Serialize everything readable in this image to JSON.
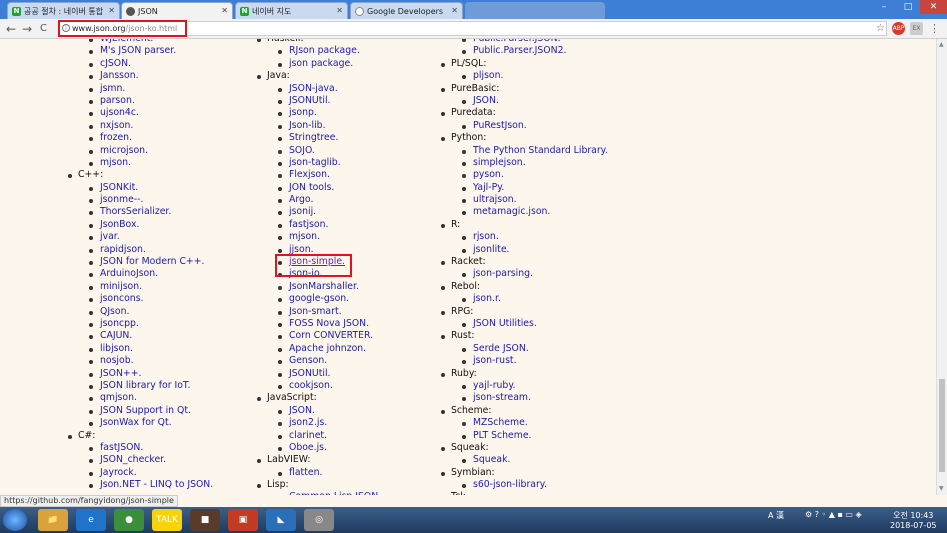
{
  "tabs": [
    {
      "label": "공공 절차 : 네이버 통합",
      "favicon_color": "#19a82b",
      "favicon_letter": "N",
      "active": false
    },
    {
      "label": "JSON",
      "favicon_color": "#555555",
      "favicon_letter": "",
      "active": true
    },
    {
      "label": "네이버 지도",
      "favicon_color": "#19a82b",
      "favicon_letter": "N",
      "active": false
    },
    {
      "label": "Google Developers",
      "favicon_color": "#888888",
      "favicon_letter": "",
      "active": false
    },
    {
      "label": "",
      "favicon_color": "#c9daf0",
      "favicon_letter": "",
      "active": false
    }
  ],
  "window_controls": {
    "minimize": "–",
    "maximize": "□",
    "close": "✕"
  },
  "toolbar": {
    "back": "←",
    "forward": "→",
    "reload": "C",
    "url_host": "www.json.org",
    "url_path": "/json-ko.html",
    "info_icon": "i",
    "star": "☆"
  },
  "columns": {
    "col1": [
      {
        "type": "lib",
        "text": "WJElement."
      },
      {
        "type": "lib",
        "text": "M's JSON parser."
      },
      {
        "type": "lib",
        "text": "cJSON."
      },
      {
        "type": "lib",
        "text": "Jansson."
      },
      {
        "type": "lib",
        "text": "jsmn."
      },
      {
        "type": "lib",
        "text": "parson."
      },
      {
        "type": "lib",
        "text": "ujson4c."
      },
      {
        "type": "lib",
        "text": "nxjson."
      },
      {
        "type": "lib",
        "text": "frozen."
      },
      {
        "type": "lib",
        "text": "microjson."
      },
      {
        "type": "lib",
        "text": "mjson."
      },
      {
        "type": "cat",
        "text": "C++:"
      },
      {
        "type": "lib",
        "text": "JSONKit."
      },
      {
        "type": "lib",
        "text": "jsonme--."
      },
      {
        "type": "lib",
        "text": "ThorsSerializer."
      },
      {
        "type": "lib",
        "text": "JsonBox."
      },
      {
        "type": "lib",
        "text": "jvar."
      },
      {
        "type": "lib",
        "text": "rapidjson."
      },
      {
        "type": "lib",
        "text": "JSON for Modern C++."
      },
      {
        "type": "lib",
        "text": "ArduinoJson."
      },
      {
        "type": "lib",
        "text": "minijson."
      },
      {
        "type": "lib",
        "text": "jsoncons."
      },
      {
        "type": "lib",
        "text": "QJson."
      },
      {
        "type": "lib",
        "text": "jsoncpp."
      },
      {
        "type": "lib",
        "text": "CAJUN."
      },
      {
        "type": "lib",
        "text": "libjson."
      },
      {
        "type": "lib",
        "text": "nosjob."
      },
      {
        "type": "lib",
        "text": "JSON++."
      },
      {
        "type": "lib",
        "text": "JSON library for IoT."
      },
      {
        "type": "lib",
        "text": "qmjson."
      },
      {
        "type": "lib",
        "text": "JSON Support in Qt."
      },
      {
        "type": "lib",
        "text": "JsonWax for Qt."
      },
      {
        "type": "cat",
        "text": "C#:"
      },
      {
        "type": "lib",
        "text": "fastJSON."
      },
      {
        "type": "lib",
        "text": "JSON_checker."
      },
      {
        "type": "lib",
        "text": "Jayrock."
      },
      {
        "type": "lib",
        "text": "Json.NET - LINQ to JSON."
      }
    ],
    "col2": [
      {
        "type": "cat",
        "text": "Haskell:"
      },
      {
        "type": "lib",
        "text": "RJson package."
      },
      {
        "type": "lib",
        "text": "json package."
      },
      {
        "type": "cat",
        "text": "Java:"
      },
      {
        "type": "lib",
        "text": "JSON-java."
      },
      {
        "type": "lib",
        "text": "JSONUtil."
      },
      {
        "type": "lib",
        "text": "jsonp."
      },
      {
        "type": "lib",
        "text": "Json-lib."
      },
      {
        "type": "lib",
        "text": "Stringtree."
      },
      {
        "type": "lib",
        "text": "SOJO."
      },
      {
        "type": "lib",
        "text": "json-taglib."
      },
      {
        "type": "lib",
        "text": "Flexjson."
      },
      {
        "type": "lib",
        "text": "JON tools."
      },
      {
        "type": "lib",
        "text": "Argo."
      },
      {
        "type": "lib",
        "text": "jsonij."
      },
      {
        "type": "lib",
        "text": "fastjson."
      },
      {
        "type": "lib",
        "text": "mjson."
      },
      {
        "type": "lib",
        "text": "jjson."
      },
      {
        "type": "lib",
        "text": "json-simple.",
        "visited": true
      },
      {
        "type": "lib",
        "text": "json-io."
      },
      {
        "type": "lib",
        "text": "JsonMarshaller."
      },
      {
        "type": "lib",
        "text": "google-gson."
      },
      {
        "type": "lib",
        "text": "Json-smart."
      },
      {
        "type": "lib",
        "text": "FOSS Nova JSON."
      },
      {
        "type": "lib",
        "text": "Corn CONVERTER."
      },
      {
        "type": "lib",
        "text": "Apache johnzon."
      },
      {
        "type": "lib",
        "text": "Genson."
      },
      {
        "type": "lib",
        "text": "JSONUtil."
      },
      {
        "type": "lib",
        "text": "cookjson."
      },
      {
        "type": "cat",
        "text": "JavaScript:"
      },
      {
        "type": "lib",
        "text": "JSON."
      },
      {
        "type": "lib",
        "text": "json2.js."
      },
      {
        "type": "lib",
        "text": "clarinet."
      },
      {
        "type": "lib",
        "text": "Oboe.js."
      },
      {
        "type": "cat",
        "text": "LabVIEW:"
      },
      {
        "type": "lib",
        "text": "flatten."
      },
      {
        "type": "cat",
        "text": "Lisp:"
      },
      {
        "type": "lib",
        "text": "Common Lisp JSON."
      }
    ],
    "col3": [
      {
        "type": "lib",
        "text": "Public.Parser.JSON."
      },
      {
        "type": "lib",
        "text": "Public.Parser.JSON2."
      },
      {
        "type": "cat",
        "text": "PL/SQL:"
      },
      {
        "type": "lib",
        "text": "pljson."
      },
      {
        "type": "cat",
        "text": "PureBasic:"
      },
      {
        "type": "lib",
        "text": "JSON."
      },
      {
        "type": "cat",
        "text": "Puredata:"
      },
      {
        "type": "lib",
        "text": "PuRestJson."
      },
      {
        "type": "cat",
        "text": "Python:"
      },
      {
        "type": "lib",
        "text": "The Python Standard Library."
      },
      {
        "type": "lib",
        "text": "simplejson."
      },
      {
        "type": "lib",
        "text": "pyson."
      },
      {
        "type": "lib",
        "text": "Yajl-Py."
      },
      {
        "type": "lib",
        "text": "ultrajson."
      },
      {
        "type": "lib",
        "text": "metamagic.json."
      },
      {
        "type": "cat",
        "text": "R:"
      },
      {
        "type": "lib",
        "text": "rjson."
      },
      {
        "type": "lib",
        "text": "jsonlite."
      },
      {
        "type": "cat",
        "text": "Racket:"
      },
      {
        "type": "lib",
        "text": "json-parsing."
      },
      {
        "type": "cat",
        "text": "Rebol:"
      },
      {
        "type": "lib",
        "text": "json.r."
      },
      {
        "type": "cat",
        "text": "RPG:"
      },
      {
        "type": "lib",
        "text": "JSON Utilities."
      },
      {
        "type": "cat",
        "text": "Rust:"
      },
      {
        "type": "lib",
        "text": "Serde JSON."
      },
      {
        "type": "lib",
        "text": "json-rust."
      },
      {
        "type": "cat",
        "text": "Ruby:"
      },
      {
        "type": "lib",
        "text": "yajl-ruby."
      },
      {
        "type": "lib",
        "text": "json-stream."
      },
      {
        "type": "cat",
        "text": "Scheme:"
      },
      {
        "type": "lib",
        "text": "MZScheme."
      },
      {
        "type": "lib",
        "text": "PLT Scheme."
      },
      {
        "type": "cat",
        "text": "Squeak:"
      },
      {
        "type": "lib",
        "text": "Squeak."
      },
      {
        "type": "cat",
        "text": "Symbian:"
      },
      {
        "type": "lib",
        "text": "s60-json-library."
      },
      {
        "type": "cat",
        "text": "Tcl:"
      }
    ]
  },
  "status_bar": "https://github.com/fangyidong/json-simple",
  "taskbar": {
    "apps": [
      {
        "name": "explorer",
        "label": "📁",
        "color": "#d9a23a"
      },
      {
        "name": "ie",
        "label": "e",
        "color": "#1f74c9"
      },
      {
        "name": "chrome",
        "label": "●",
        "color": "#3a8f3a"
      },
      {
        "name": "kakaotalk",
        "label": "TALK",
        "color": "#f7d40a"
      },
      {
        "name": "app5",
        "label": "■",
        "color": "#5a3b2a"
      },
      {
        "name": "app6",
        "label": "▣",
        "color": "#c23b22"
      },
      {
        "name": "vscode",
        "label": "◣",
        "color": "#2a6fb8"
      },
      {
        "name": "app8",
        "label": "◎",
        "color": "#888888"
      }
    ],
    "tray_ime": "A 漢",
    "clock_time": "오전 10:43",
    "clock_date": "2018-07-05"
  }
}
